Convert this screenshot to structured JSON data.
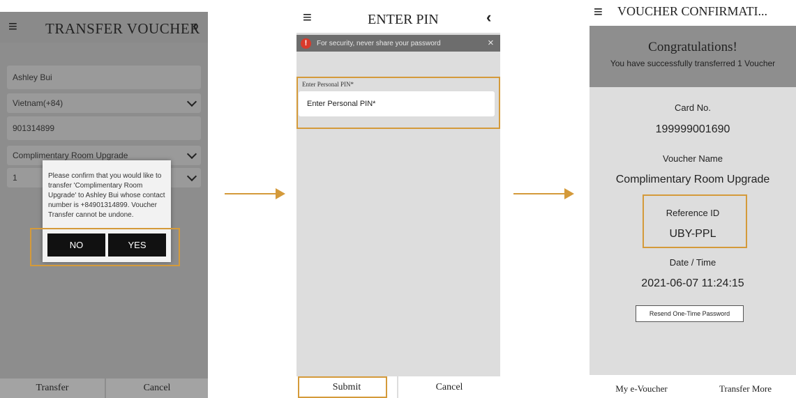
{
  "screen1": {
    "title": "TRANSFER VOUCHER",
    "menu_icon": "≡",
    "back_icon": "‹",
    "fields": {
      "name": "Ashley Bui",
      "country_code": "Vietnam(+84)",
      "phone": "901314899",
      "voucher": "Complimentary Room Upgrade",
      "quantity": "1"
    },
    "dialog": {
      "message": "Please confirm that you would like to transfer 'Complimentary Room Upgrade' to Ashley Bui whose contact number is +84901314899. Voucher Transfer cannot be undone.",
      "no_label": "NO",
      "yes_label": "YES"
    },
    "footer": {
      "transfer_label": "Transfer",
      "cancel_label": "Cancel"
    }
  },
  "screen2": {
    "title": "ENTER PIN",
    "menu_icon": "≡",
    "back_icon": "‹",
    "banner": {
      "icon": "!",
      "text": "For security, never share your password",
      "close": "×"
    },
    "pin_label": "Enter Personal PIN*",
    "pin_placeholder": "Enter Personal PIN*",
    "footer": {
      "submit_label": "Submit",
      "cancel_label": "Cancel"
    }
  },
  "screen3": {
    "title": "VOUCHER CONFIRMATI...",
    "menu_icon": "≡",
    "congrats_title": "Congratulations!",
    "congrats_message": "You have successfully transferred 1 Voucher",
    "card_no_label": "Card No.",
    "card_no_value": "199999001690",
    "voucher_name_label": "Voucher Name",
    "voucher_name_value": "Complimentary Room Upgrade",
    "reference_label": "Reference ID",
    "reference_value": "UBY-PPL",
    "datetime_label": "Date / Time",
    "datetime_value": "2021-06-07 11:24:15",
    "resend_label": "Resend One-Time Password",
    "footer": {
      "my_evoucher_label": "My e-Voucher",
      "transfer_more_label": "Transfer More"
    }
  },
  "colors": {
    "highlight": "#d49a3a",
    "overlay_gray": "#8d8d8d",
    "alert_red": "#d93a2b"
  }
}
